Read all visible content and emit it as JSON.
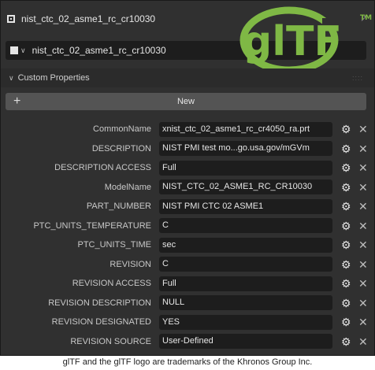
{
  "header": {
    "object_name": "nist_ctc_02_asme1_rc_cr10030",
    "mesh_name": "nist_ctc_02_asme1_rc_cr10030"
  },
  "logo": {
    "text": "glTF",
    "tm": "TM",
    "color": "#7fb845"
  },
  "section": {
    "title": "Custom Properties"
  },
  "new_button": {
    "label": "New"
  },
  "properties": [
    {
      "name": "CommonName",
      "value": "xnist_ctc_02_asme1_rc_cr4050_ra.prt"
    },
    {
      "name": "DESCRIPTION",
      "value": "NIST PMI test mo...go.usa.gov/mGVm"
    },
    {
      "name": "DESCRIPTION ACCESS",
      "value": "Full"
    },
    {
      "name": "ModelName",
      "value": "NIST_CTC_02_ASME1_RC_CR10030"
    },
    {
      "name": "PART_NUMBER",
      "value": "NIST PMI CTC 02 ASME1"
    },
    {
      "name": "PTC_UNITS_TEMPERATURE",
      "value": "C"
    },
    {
      "name": "PTC_UNITS_TIME",
      "value": "sec"
    },
    {
      "name": "REVISION",
      "value": "C"
    },
    {
      "name": "REVISION ACCESS",
      "value": "Full"
    },
    {
      "name": "REVISION DESCRIPTION",
      "value": "NULL"
    },
    {
      "name": "REVISION DESIGNATED",
      "value": "YES"
    },
    {
      "name": "REVISION SOURCE",
      "value": "User-Defined"
    }
  ],
  "caption": "glTF and the glTF logo are trademarks of the Khronos Group Inc."
}
